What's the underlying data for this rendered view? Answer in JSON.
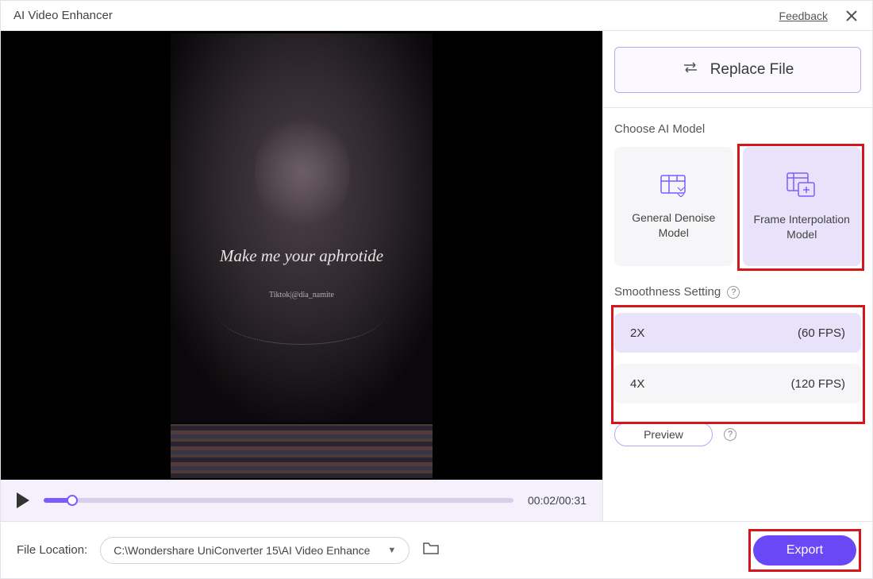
{
  "titlebar": {
    "title": "AI Video Enhancer",
    "feedback": "Feedback"
  },
  "video_overlay": {
    "caption": "Make me your aphrotide",
    "subcaption": "Tiktok|@dia_namite"
  },
  "playback": {
    "current": "00:02",
    "total": "00:31",
    "progress_pct": 6
  },
  "right": {
    "replace_label": "Replace File",
    "choose_model_label": "Choose AI Model",
    "models": [
      {
        "label": "General Denoise Model",
        "selected": false
      },
      {
        "label": "Frame Interpolation Model",
        "selected": true
      }
    ],
    "smoothness_label": "Smoothness Setting",
    "smoothness_options": [
      {
        "mult": "2X",
        "fps": "(60 FPS)",
        "selected": true
      },
      {
        "mult": "4X",
        "fps": "(120 FPS)",
        "selected": false
      }
    ],
    "preview_label": "Preview"
  },
  "footer": {
    "file_location_label": "File Location:",
    "path": "C:\\Wondershare UniConverter 15\\AI Video Enhance",
    "export_label": "Export"
  },
  "colors": {
    "accent": "#7c5cff",
    "highlight_box": "#d4151b"
  }
}
